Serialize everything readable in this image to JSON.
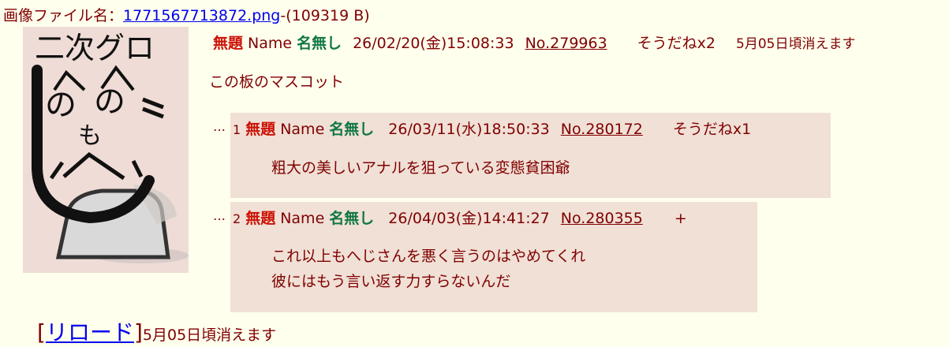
{
  "file": {
    "label": "画像ファイル名：",
    "name": "1771567713872.png",
    "size": "-(109319 B)"
  },
  "thumbnail": {
    "text_top": "二次グロ",
    "text_mid": "も"
  },
  "op": {
    "subject": "無題",
    "name_label": "Name",
    "name": "名無し",
    "datetime": "26/02/20(金)15:08:33",
    "number": "No.279963",
    "sodane": "そうだねx2",
    "expire": "5月05日頃消えます",
    "body": "この板のマスコット"
  },
  "replies": [
    {
      "dots": "…",
      "index": "1",
      "subject": "無題",
      "name_label": "Name",
      "name": "名無し",
      "datetime": "26/03/11(水)18:50:33",
      "number": "No.280172",
      "sodane": "そうだねx1",
      "lines": [
        "粗大の美しいアナルを狙っている変態貧困爺"
      ]
    },
    {
      "dots": "…",
      "index": "2",
      "subject": "無題",
      "name_label": "Name",
      "name": "名無し",
      "datetime": "26/04/03(金)14:41:27",
      "number": "No.280355",
      "sodane": "+",
      "lines": [
        "これ以上もへじさんを悪く言うのはやめてくれ",
        "彼にはもう言い返す力すらないんだ"
      ]
    }
  ],
  "footer": {
    "bracket_open": "[",
    "reload": "リロード",
    "bracket_close": "]",
    "expire": "5月05日頃消えます"
  }
}
